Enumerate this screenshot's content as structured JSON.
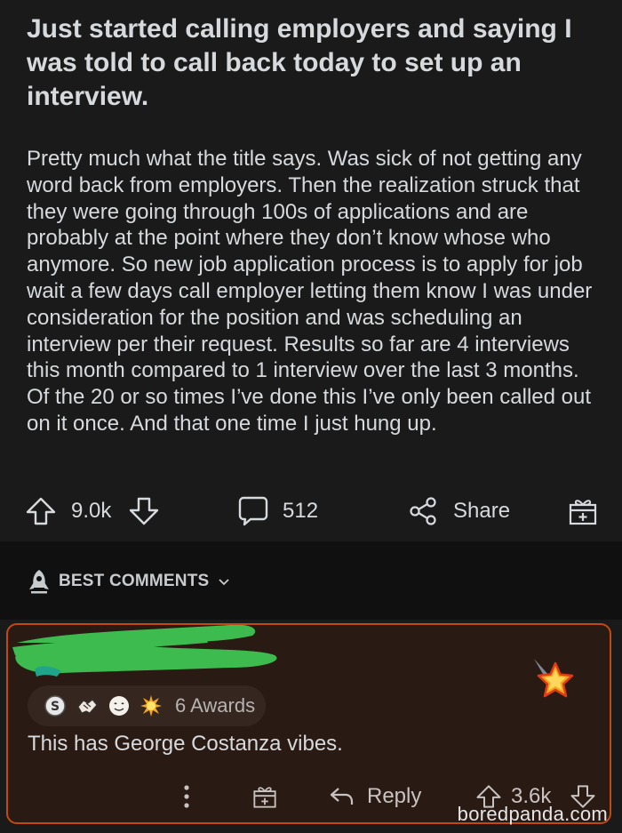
{
  "post": {
    "title": "Just started calling employers and saying I was told to call back today to set up an interview.",
    "body": "Pretty much what the title says. Was sick of not getting any word back from employers. Then the realization struck that they were going through 100s of applications and are probably at the point where they don’t know whose who anymore. So new job application process is to apply for job wait a few days call employer letting them know I was under consideration for the position and was scheduling an interview per their request. Results so far are 4 interviews this month compared to 1 interview over the last 3 months. Of the 20 or so times I’ve done this I’ve only been called out on it once. And that one time I just hung up.",
    "upvotes": "9.0k",
    "comments": "512",
    "share_label": "Share"
  },
  "sort": {
    "label": "BEST COMMENTS"
  },
  "comment": {
    "awards_label": "6 Awards",
    "text": "This has George Costanza vibes.",
    "reply_label": "Reply",
    "votes": "3.6k"
  },
  "watermark": "boredpanda.com",
  "colors": {
    "background": "#1a1a1b",
    "comment_border": "#c24a12",
    "scribble": "#3dbb4f"
  },
  "icons": [
    "upvote-icon",
    "downvote-icon",
    "comment-icon",
    "share-icon",
    "award-gift-icon",
    "rocket-icon",
    "chevron-down-icon",
    "more-icon",
    "reply-icon",
    "star-icon"
  ]
}
